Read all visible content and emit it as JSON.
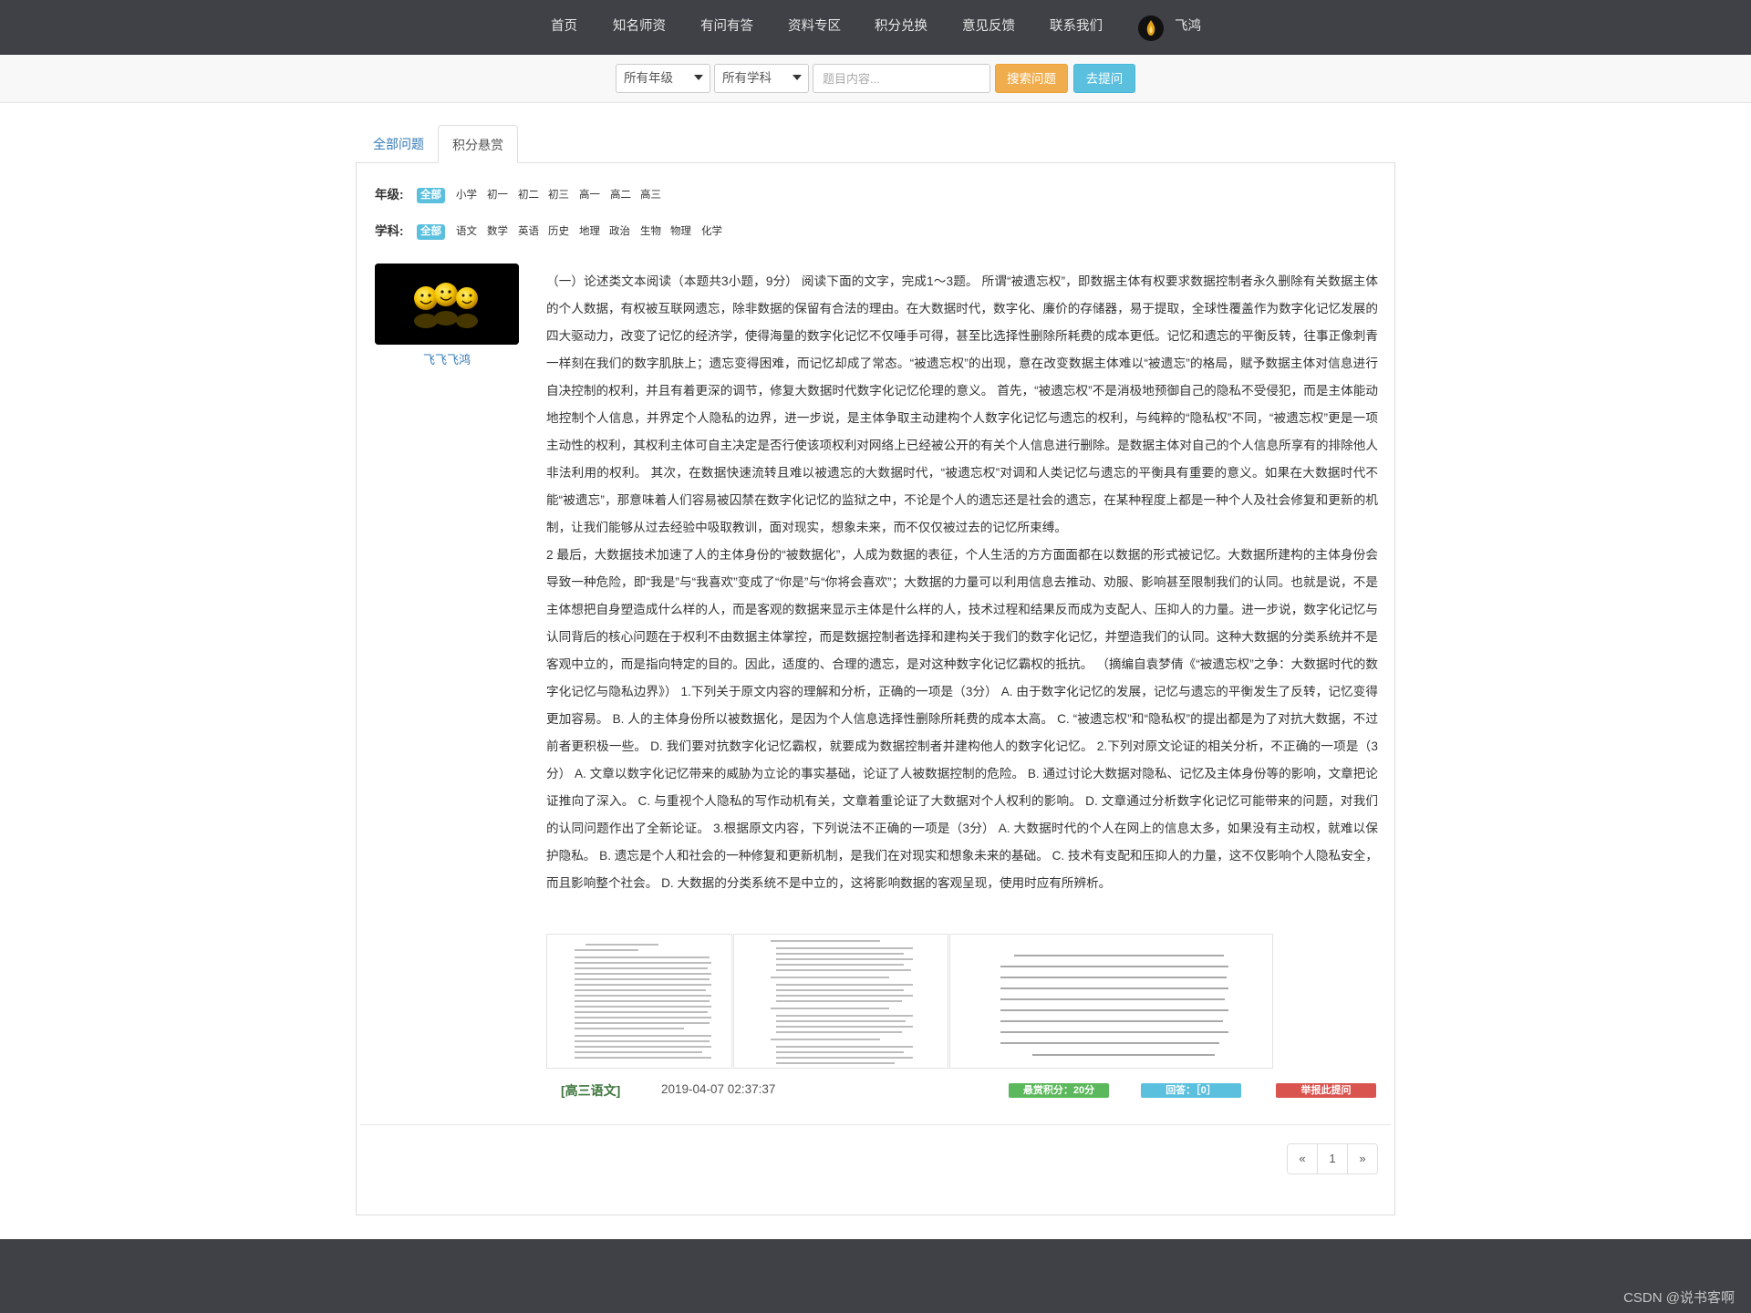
{
  "nav": {
    "items": [
      "首页",
      "知名师资",
      "有问有答",
      "资料专区",
      "积分兑换",
      "意见反馈",
      "联系我们"
    ],
    "user_name": "飞鸿"
  },
  "search": {
    "grade_select": "所有年级",
    "subject_select": "所有学科",
    "keyword_placeholder": "题目内容...",
    "search_button": "搜索问题",
    "ask_button": "去提问"
  },
  "tabs": {
    "all": "全部问题",
    "reward": "积分悬赏"
  },
  "filters": {
    "grade_label": "年级:",
    "grades": [
      "全部",
      "小学",
      "初一",
      "初二",
      "初三",
      "高一",
      "高二",
      "高三"
    ],
    "subject_label": "学科:",
    "subjects": [
      "全部",
      "语文",
      "数学",
      "英语",
      "历史",
      "地理",
      "政治",
      "生物",
      "物理",
      "化学"
    ]
  },
  "question": {
    "user_name": "飞飞飞鸿",
    "content": "（一）论述类文本阅读（本题共3小题，9分） 阅读下面的文字，完成1～3题。 所谓“被遗忘权”，即数据主体有权要求数据控制者永久删除有关数据主体的个人数据，有权被互联网遗忘，除非数据的保留有合法的理由。在大数据时代，数字化、廉价的存储器，易于提取，全球性覆盖作为数字化记忆发展的四大驱动力，改变了记忆的经济学，使得海量的数字化记忆不仅唾手可得，甚至比选择性删除所耗费的成本更低。记忆和遗忘的平衡反转，往事正像刺青一样刻在我们的数字肌肤上；遗忘变得困难，而记忆却成了常态。“被遗忘权”的出现，意在改变数据主体难以“被遗忘”的格局，赋予数据主体对信息进行自决控制的权利，并且有着更深的调节，修复大数据时代数字化记忆伦理的意义。 首先，“被遗忘权”不是消极地预御自己的隐私不受侵犯，而是主体能动地控制个人信息，并界定个人隐私的边界，进一步说，是主体争取主动建构个人数字化记忆与遗忘的权利，与纯粹的“隐私权”不同，“被遗忘权”更是一项主动性的权利，其权利主体可自主决定是否行使该项权利对网络上已经被公开的有关个人信息进行删除。是数据主体对自己的个人信息所享有的排除他人非法利用的权利。 其次，在数据快速流转且难以被遗忘的大数据时代，“被遗忘权”对调和人类记忆与遗忘的平衡具有重要的意义。如果在大数据时代不能“被遗忘”，那意味着人们容易被囚禁在数字化记忆的监狱之中，不论是个人的遗忘还是社会的遗忘，在某种程度上都是一种个人及社会修复和更新的机制，让我们能够从过去经验中吸取教训，面对现实，想象未来，而不仅仅被过去的记忆所束缚。\n2 最后，大数据技术加速了人的主体身份的“被数据化”，人成为数据的表征，个人生活的方方面面都在以数据的形式被记忆。大数据所建构的主体身份会导致一种危险，即“我是”与“我喜欢”变成了“你是”与“你将会喜欢”；大数据的力量可以利用信息去推动、劝服、影响甚至限制我们的认同。也就是说，不是主体想把自身塑造成什么样的人，而是客观的数据来显示主体是什么样的人，技术过程和结果反而成为支配人、压抑人的力量。进一步说，数字化记忆与认同背后的核心问题在于权利不由数据主体掌控，而是数据控制者选择和建构关于我们的数字化记忆，并塑造我们的认同。这种大数据的分类系统并不是客观中立的，而是指向特定的目的。因此，适度的、合理的遗忘，是对这种数字化记忆霸权的抵抗。 （摘编自袁梦倩《“被遗忘权”之争：大数据时代的数字化记忆与隐私边界》） 1.下列关于原文内容的理解和分析，正确的一项是（3分） A. 由于数字化记忆的发展，记忆与遗忘的平衡发生了反转，记忆变得更加容易。 B. 人的主体身份所以被数据化，是因为个人信息选择性删除所耗费的成本太高。 C. “被遗忘权”和“隐私权”的提出都是为了对抗大数据，不过前者更积极一些。 D. 我们要对抗数字化记忆霸权，就要成为数据控制者并建构他人的数字化记忆。 2.下列对原文论证的相关分析，不正确的一项是（3分） A. 文章以数字化记忆带来的威胁为立论的事实基础，论证了人被数据控制的危险。 B. 通过讨论大数据对隐私、记忆及主体身份等的影响，文章把论证推向了深入。 C. 与重视个人隐私的写作动机有关，文章着重论证了大数据对个人权利的影响。 D. 文章通过分析数字化记忆可能带来的问题，对我们的认同问题作出了全新论证。 3.根据原文内容，下列说法不正确的一项是（3分） A. 大数据时代的个人在网上的信息太多，如果没有主动权，就难以保护隐私。 B. 遗忘是个人和社会的一种修复和更新机制，是我们在对现实和想象未来的基础。 C. 技术有支配和压抑人的力量，这不仅影响个人隐私安全，而且影响整个社会。 D. 大数据的分类系统不是中立的，这将影响数据的客观呈现，使用时应有所辨析。",
    "subject_tag": "[高三语文]",
    "time": "2019-04-07 02:37:37",
    "reward_badge": "悬赏积分：20分",
    "answer_badge": "回答：［0］",
    "report_badge": "举报此提问"
  },
  "pagination": {
    "prev": "«",
    "current": "1",
    "next": "»"
  },
  "watermark": "CSDN @说书客啊",
  "colors": {
    "nav_bg": "#3f4146",
    "link": "#337ab7",
    "search_btn": "#f0ad4e",
    "ask_btn": "#5bc0de",
    "reward_badge": "#5cb85c",
    "answer_badge": "#5bc0de",
    "report_badge": "#d9534f"
  }
}
